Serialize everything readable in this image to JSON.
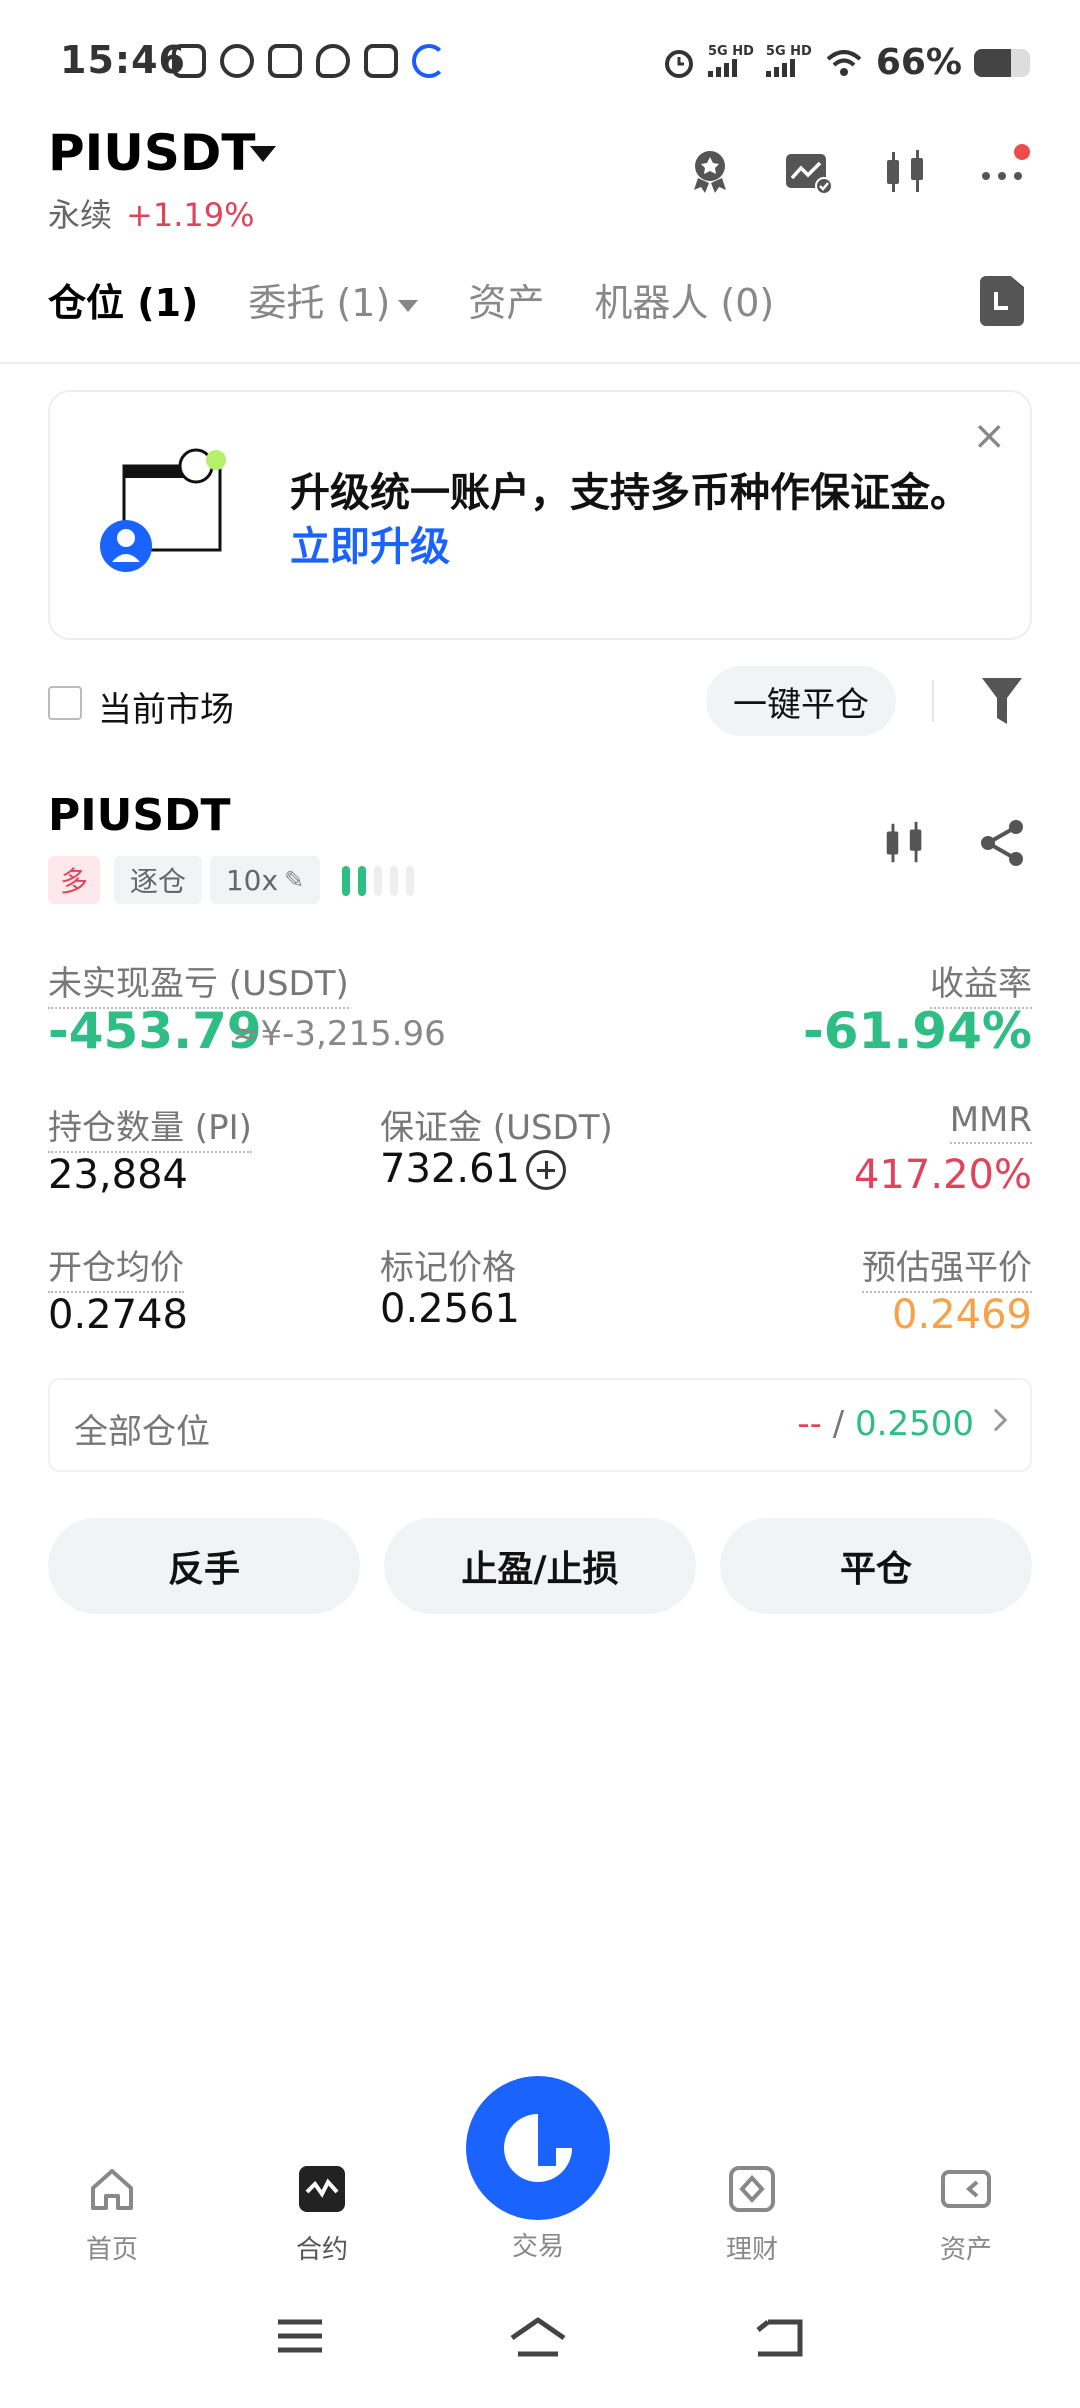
{
  "status_bar": {
    "time": "15:46",
    "network1": "5G HD",
    "network2": "5G HD",
    "battery_text": "66%",
    "battery_level": 0.66
  },
  "header": {
    "symbol": "PIUSDT",
    "contract_type": "永续",
    "change": "+1.19%"
  },
  "tabs": [
    {
      "label": "仓位 (1)",
      "active": true
    },
    {
      "label": "委托 (1)",
      "active": false
    },
    {
      "label": "资产",
      "active": false
    },
    {
      "label": "机器人 (0)",
      "active": false
    }
  ],
  "banner": {
    "text": "升级统一账户，支持多币种作保证金。",
    "link": "立即升级",
    "close": "×"
  },
  "filter": {
    "current_market": "当前市场",
    "close_all": "一键平仓"
  },
  "position": {
    "symbol": "PIUSDT",
    "side": "多",
    "margin_mode": "逐仓",
    "leverage": "10x",
    "risk_level": 2,
    "unrealized_pnl_label": "未实现盈亏 (USDT)",
    "unrealized_pnl": "-453.79",
    "unrealized_pnl_cny": "≈¥-3,215.96",
    "roe_label": "收益率",
    "roe": "-61.94%",
    "qty_label": "持仓数量 (PI)",
    "qty": "23,884",
    "margin_label": "保证金 (USDT)",
    "margin": "732.61",
    "mmr_label": "MMR",
    "mmr": "417.20%",
    "entry_label": "开仓均价",
    "entry": "0.2748",
    "mark_label": "标记价格",
    "mark": "0.2561",
    "liq_label": "预估强平价",
    "liq": "0.2469"
  },
  "all_positions": {
    "label": "全部仓位",
    "value_left": "--",
    "separator": "/",
    "value_right": "0.2500"
  },
  "actions": {
    "reverse": "反手",
    "tpsl": "止盈/止损",
    "close": "平仓"
  },
  "bottom_nav": [
    {
      "label": "首页",
      "icon": "home-icon"
    },
    {
      "label": "合约",
      "icon": "futures-icon"
    },
    {
      "label": "交易",
      "icon": "trade-icon"
    },
    {
      "label": "理财",
      "icon": "earn-icon"
    },
    {
      "label": "资产",
      "icon": "wallet-icon"
    }
  ],
  "colors": {
    "accent": "#1a63ff",
    "up": "#2ebd85",
    "down": "#e0445b",
    "warning": "#f7a14a"
  }
}
